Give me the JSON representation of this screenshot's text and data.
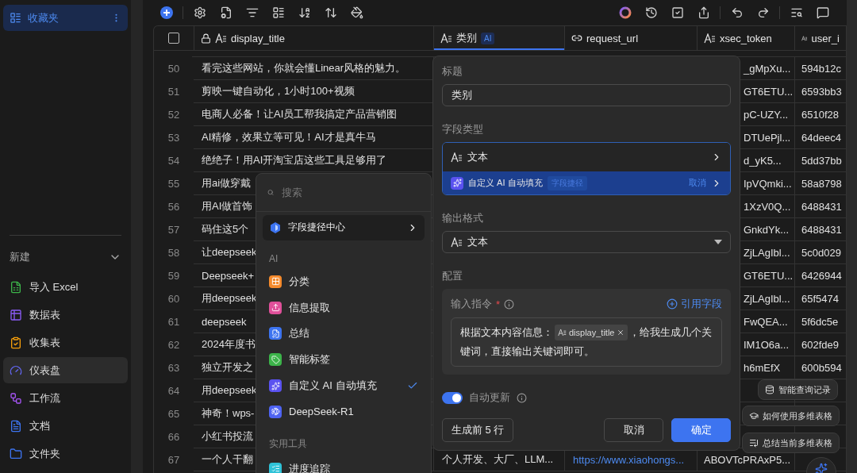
{
  "sidebar": {
    "favorites": {
      "label": "收藏夹",
      "selected": true
    },
    "new_section": {
      "label": "新建",
      "expanded": true
    },
    "items": [
      {
        "label": "导入 Excel",
        "selected": false
      },
      {
        "label": "数据表",
        "selected": false
      },
      {
        "label": "收集表",
        "selected": false
      },
      {
        "label": "仪表盘",
        "selected": true
      },
      {
        "label": "工作流",
        "selected": false
      },
      {
        "label": "文档",
        "selected": false
      },
      {
        "label": "文件夹",
        "selected": false
      }
    ]
  },
  "table": {
    "header_checkbox": {
      "checked": false
    },
    "columns": [
      {
        "label": "display_title",
        "kind": "text",
        "locked": true,
        "selected": false
      },
      {
        "label": "类别",
        "kind": "text",
        "badge": "AI",
        "locked": false,
        "selected": true
      },
      {
        "label": "request_url",
        "kind": "link",
        "locked": false,
        "selected": false
      },
      {
        "label": "xsec_token",
        "kind": "text",
        "locked": false,
        "selected": false
      },
      {
        "label": "user_i",
        "kind": "text",
        "locked": false,
        "selected": false
      }
    ],
    "rows": [
      {
        "number": "50",
        "display_title": "看完这些网站，你就会懂Linear风格的魅力。",
        "xsec_token": "_gMpXu...",
        "column_5": "594b12c"
      },
      {
        "number": "51",
        "display_title": "剪映一键自动化，1小时100+视频",
        "xsec_token": "GT6ETU...",
        "column_5": "6593bb3"
      },
      {
        "number": "52",
        "display_title": "电商人必备！让AI员工帮我搞定产品营销图",
        "xsec_token": "pC-UZY...",
        "column_5": "6510f28"
      },
      {
        "number": "53",
        "display_title": "AI精修，效果立等可见！AI才是真牛马",
        "xsec_token": "DTUePjl...",
        "column_5": "64deec4"
      },
      {
        "number": "54",
        "display_title": "绝绝子！用AI开淘宝店这些工具足够用了",
        "xsec_token": "d_yK5...",
        "column_5": "5dd37bb"
      },
      {
        "number": "55",
        "display_title": "用ai做穿戴",
        "xsec_token": "IpVQmki...",
        "column_5": "58a8798"
      },
      {
        "number": "56",
        "display_title": "用AI做首饰",
        "xsec_token": "1XzV0Q...",
        "column_5": "6488431"
      },
      {
        "number": "57",
        "display_title": "码住这5个",
        "xsec_token": "GnkdYk...",
        "column_5": "6488431"
      },
      {
        "number": "58",
        "display_title": "让deepseek",
        "xsec_token": "ZjLAgIbl...",
        "column_5": "5c0d029"
      },
      {
        "number": "59",
        "display_title": "Deepseek+",
        "xsec_token": "GT6ETU...",
        "column_5": "6426944"
      },
      {
        "number": "60",
        "display_title": "用deepseek",
        "xsec_token": "ZjLAgIbl...",
        "column_5": "65f5474"
      },
      {
        "number": "61",
        "display_title": "deepseek",
        "xsec_token": "FwQEA...",
        "column_5": "5f6dc5e"
      },
      {
        "number": "62",
        "display_title": "2024年度书",
        "xsec_token": "IM1O6a...",
        "column_5": "602fde9"
      },
      {
        "number": "63",
        "display_title": "独立开发之",
        "xsec_token": "h6mEfX",
        "column_5": "600b594"
      },
      {
        "number": "64",
        "display_title": "用deepseek"
      },
      {
        "number": "65",
        "display_title": "神奇！wps-"
      },
      {
        "number": "66",
        "display_title": "小红书投流"
      },
      {
        "number": "67",
        "display_title": "一个人干翻",
        "category": "个人开发、大厂、LLM...",
        "request_url": "https://www.xiaohongs...",
        "xsec_token": "ABOVTcPRAxP5..."
      }
    ]
  },
  "menu": {
    "search": {
      "placeholder": "搜索"
    },
    "shortcut": {
      "label": "字段捷径中心"
    },
    "sections": [
      {
        "title": "AI",
        "items": [
          {
            "label": "分类",
            "color": "#f58a2c",
            "checked": false
          },
          {
            "label": "信息提取",
            "color": "#e0509a",
            "checked": false
          },
          {
            "label": "总结",
            "color": "#3d74f0",
            "checked": false
          },
          {
            "label": "智能标签",
            "color": "#3cb44a",
            "checked": false
          },
          {
            "label": "自定义 AI 自动填充",
            "color": "#5a52f0",
            "checked": true
          },
          {
            "label": "DeepSeek-R1",
            "color": "#4e63f2",
            "checked": false
          }
        ]
      },
      {
        "title": "实用工具",
        "items": [
          {
            "label": "进度追踪",
            "color": "#2fc3d8",
            "checked": false
          }
        ]
      }
    ]
  },
  "panel": {
    "title_label": "标题",
    "title_value": "类别",
    "field_type_label": "字段类型",
    "field_type": "文本",
    "shortcut": {
      "label": "自定义 AI 自动填充",
      "tag": "字段捷径",
      "action": "取消"
    },
    "output_label": "输出格式",
    "output_format": "文本",
    "config_label": "配置",
    "instruction": {
      "label": "输入指令",
      "required_mark": "*",
      "reference": "引用字段",
      "before": "根据文本内容信息：",
      "chip": "display_title",
      "after": "，给我生成几个关",
      "continuation": "键词，直接输出关键词即可。"
    },
    "auto_update": {
      "label": "自动更新",
      "on": true
    },
    "buttons": {
      "preview": "生成前 5 行",
      "cancel": "取消",
      "confirm": "确定"
    }
  },
  "assistant": [
    {
      "label": "智能查询记录"
    },
    {
      "label": "如何使用多维表格"
    },
    {
      "label": "总结当前多维表格"
    }
  ]
}
